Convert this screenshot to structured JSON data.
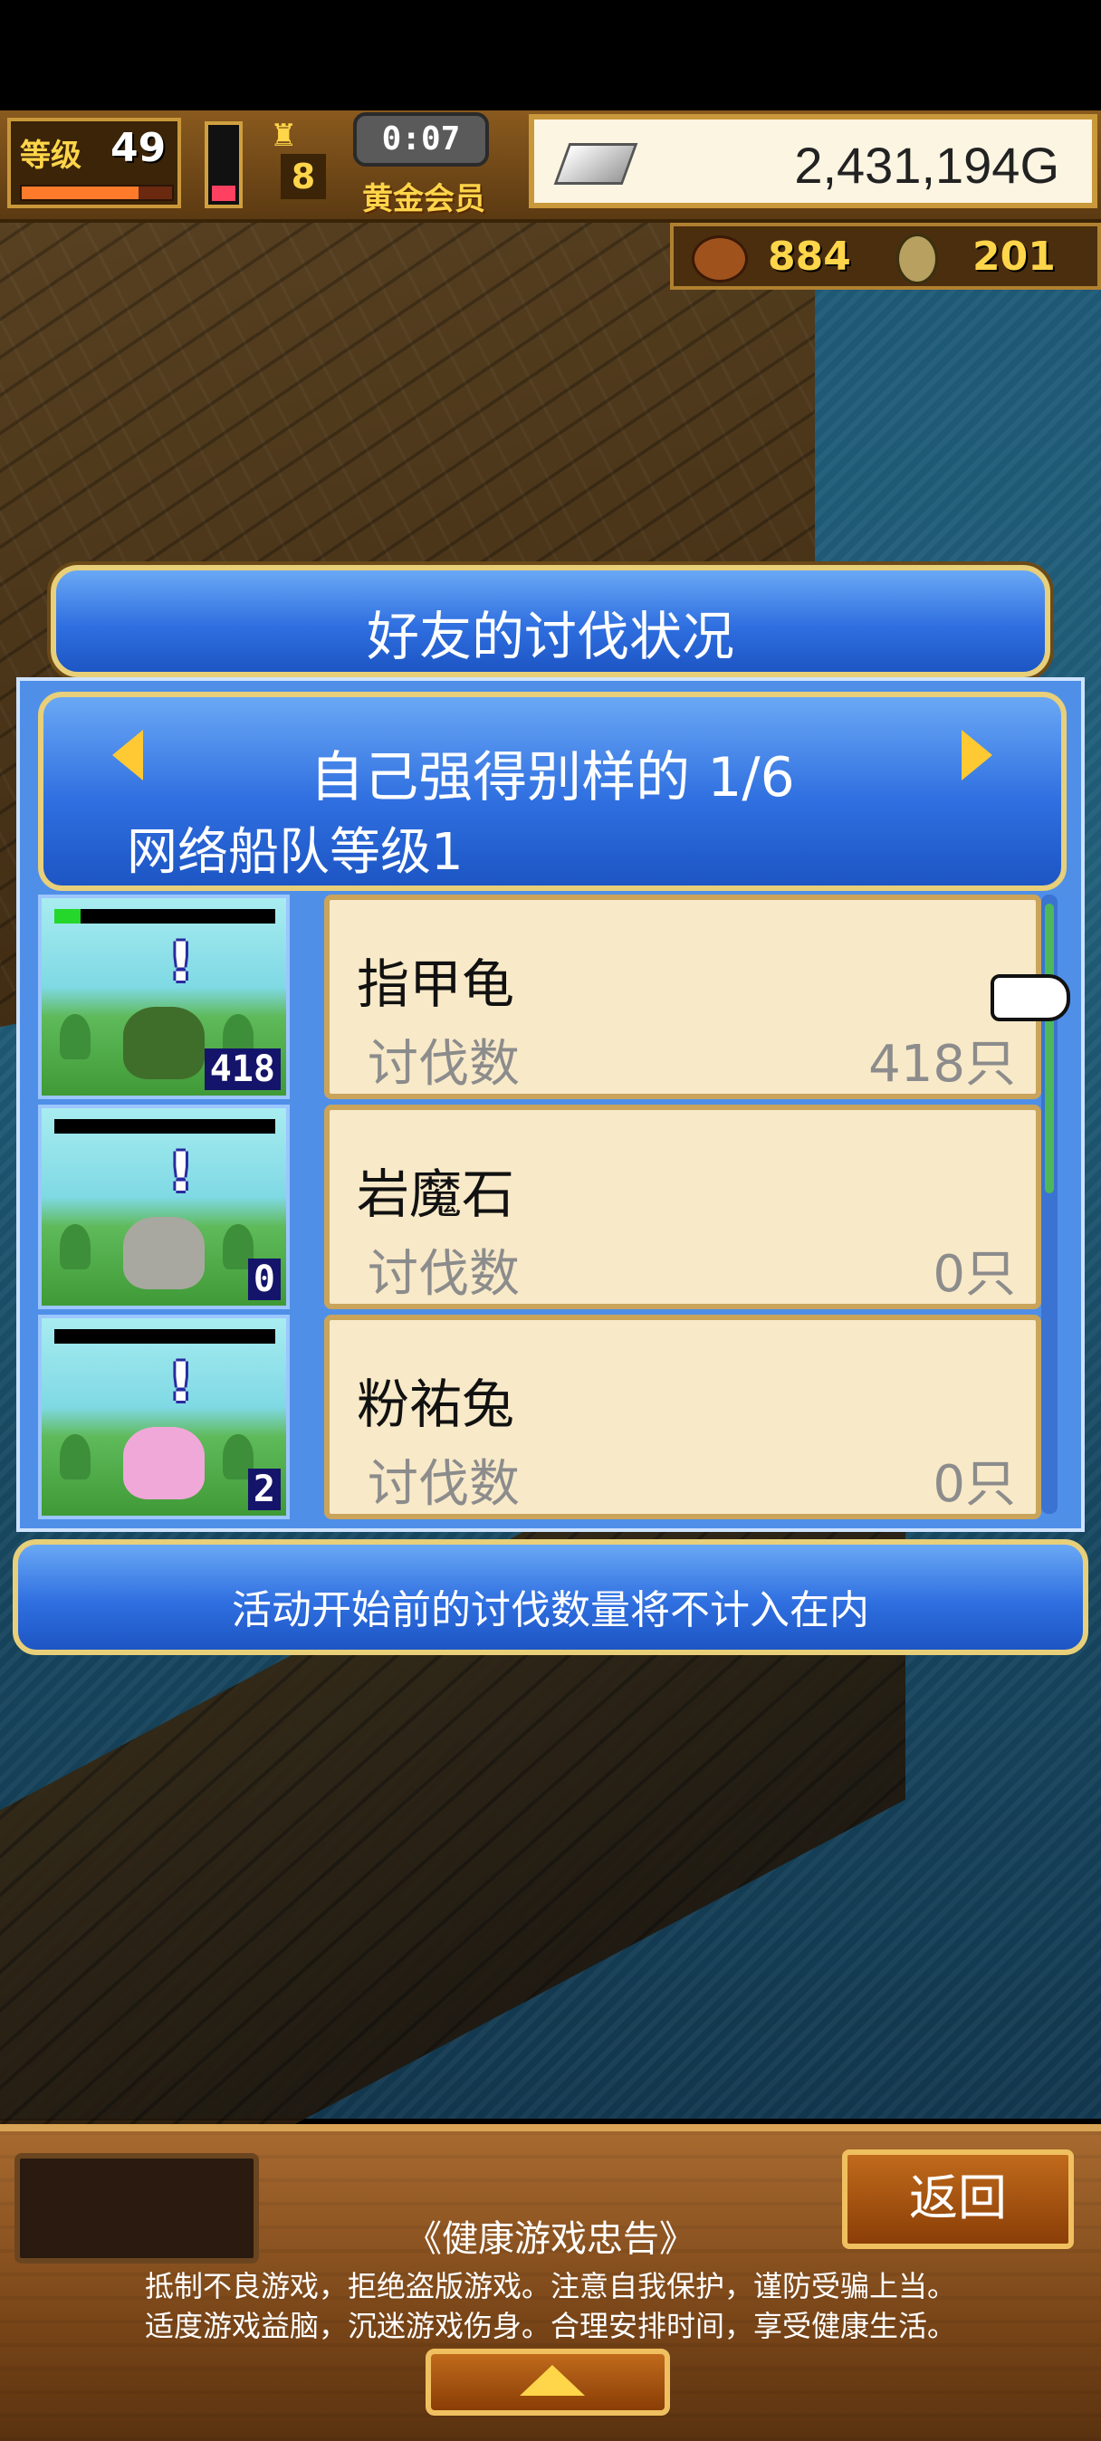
{
  "hud": {
    "level_label": "等级",
    "level_value": "49",
    "exp_fraction": 0.78,
    "stamina_fraction": 0.2,
    "rank_value": "8",
    "timer": "0:07",
    "membership": "黄金会员",
    "gold": "2,431,194G",
    "resource1_value": "884",
    "resource2_value": "201"
  },
  "dialog": {
    "title": "好友的讨伐状况",
    "friend_name": "自己强得别样的 1/6",
    "fleet_level": "网络船队等级1",
    "note": "活动开始前的讨伐数量将不计入在内"
  },
  "entries": [
    {
      "name": "指甲龟",
      "label": "讨伐数",
      "count": "418只",
      "badge": "418",
      "hp_fraction": 0.12,
      "monster_color": "#3f6e2a",
      "icon": "spiky-turtle-icon"
    },
    {
      "name": "岩魔石",
      "label": "讨伐数",
      "count": "0只",
      "badge": "0",
      "hp_fraction": 0,
      "monster_color": "#a8a8a0",
      "icon": "rock-golem-icon"
    },
    {
      "name": "粉祐兔",
      "label": "讨伐数",
      "count": "0只",
      "badge": "2",
      "hp_fraction": 0,
      "monster_color": "#f0a8d8",
      "icon": "pink-rabbit-icon"
    }
  ],
  "bottom": {
    "back_label": "返回",
    "health_title": "《健康游戏忠告》",
    "health_line1": "抵制不良游戏，拒绝盗版游戏。注意自我保护，谨防受骗上当。",
    "health_line2": "适度游戏益脑，沉迷游戏伤身。合理安排时间，享受健康生活。"
  },
  "colors": {
    "accent_blue": "#2f6fe0",
    "card_bg": "#f8e9c8",
    "gold_border": "#e8cf7a"
  }
}
